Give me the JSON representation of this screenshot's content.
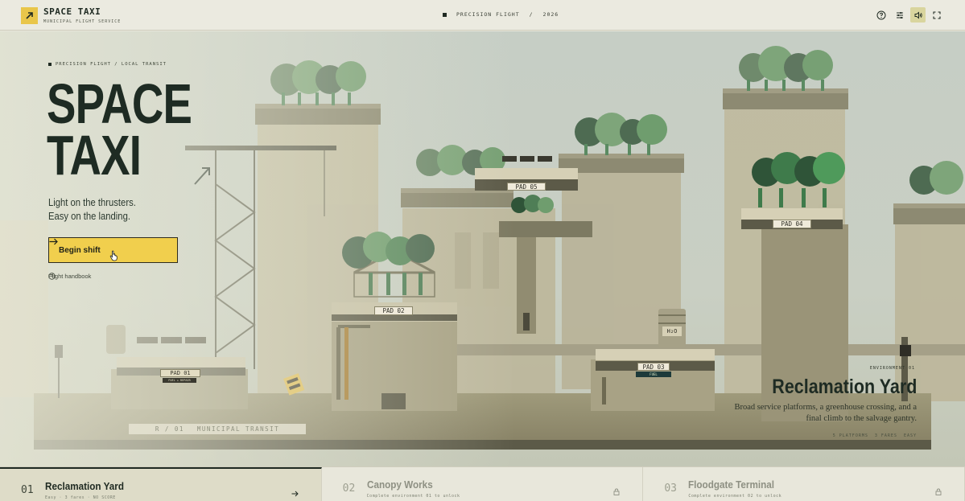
{
  "brand": {
    "title": "SPACE TAXI",
    "subtitle": "MUNICIPAL FLIGHT SERVICE"
  },
  "header_meta": {
    "left": "PRECISION FLIGHT",
    "separator": "/",
    "year": "2026"
  },
  "top_icons": [
    "help-icon",
    "settings-sliders-icon",
    "sound-on-icon",
    "fullscreen-icon"
  ],
  "hero": {
    "crumb": "PRECISION FLIGHT / LOCAL TRANSIT",
    "title_line1": "SPACE",
    "title_line2": "TAXI",
    "tag_line1": "Light on the thrusters.",
    "tag_line2": "Easy on the landing.",
    "begin_label": "Begin shift",
    "handbook_label": "Flight handbook"
  },
  "route": {
    "code": "R / 01",
    "name": "MUNICIPAL TRANSIT"
  },
  "pads": {
    "pad01": "PAD 01",
    "pad01_sub": "FUEL + REPAIR",
    "pad02": "PAD 02",
    "pad03": "PAD 03",
    "pad03_sub": "FUEL",
    "pad04": "PAD 04",
    "pad05": "PAD 05",
    "tank_label": "H₂O"
  },
  "environment": {
    "label": "ENVIRONMENT 01",
    "title": "Reclamation Yard",
    "desc": "Broad service platforms, a greenhouse crossing, and a final climb to the salvage gantry.",
    "stat_platforms": "5 PLATFORMS",
    "stat_fares": "3 FARES",
    "stat_difficulty": "EASY"
  },
  "tabs": [
    {
      "num": "01",
      "name": "Reclamation Yard",
      "sub": "Easy · 3 fares · NO SCORE",
      "locked": false
    },
    {
      "num": "02",
      "name": "Canopy Works",
      "sub": "Complete environment 01 to unlock",
      "locked": true
    },
    {
      "num": "03",
      "name": "Floodgate Terminal",
      "sub": "Complete environment 02 to unlock",
      "locked": true
    }
  ],
  "colors": {
    "accent": "#f1cf4d",
    "ink": "#1e2b23",
    "sky": "#c6cec5",
    "platform": "#8e8a6c"
  }
}
